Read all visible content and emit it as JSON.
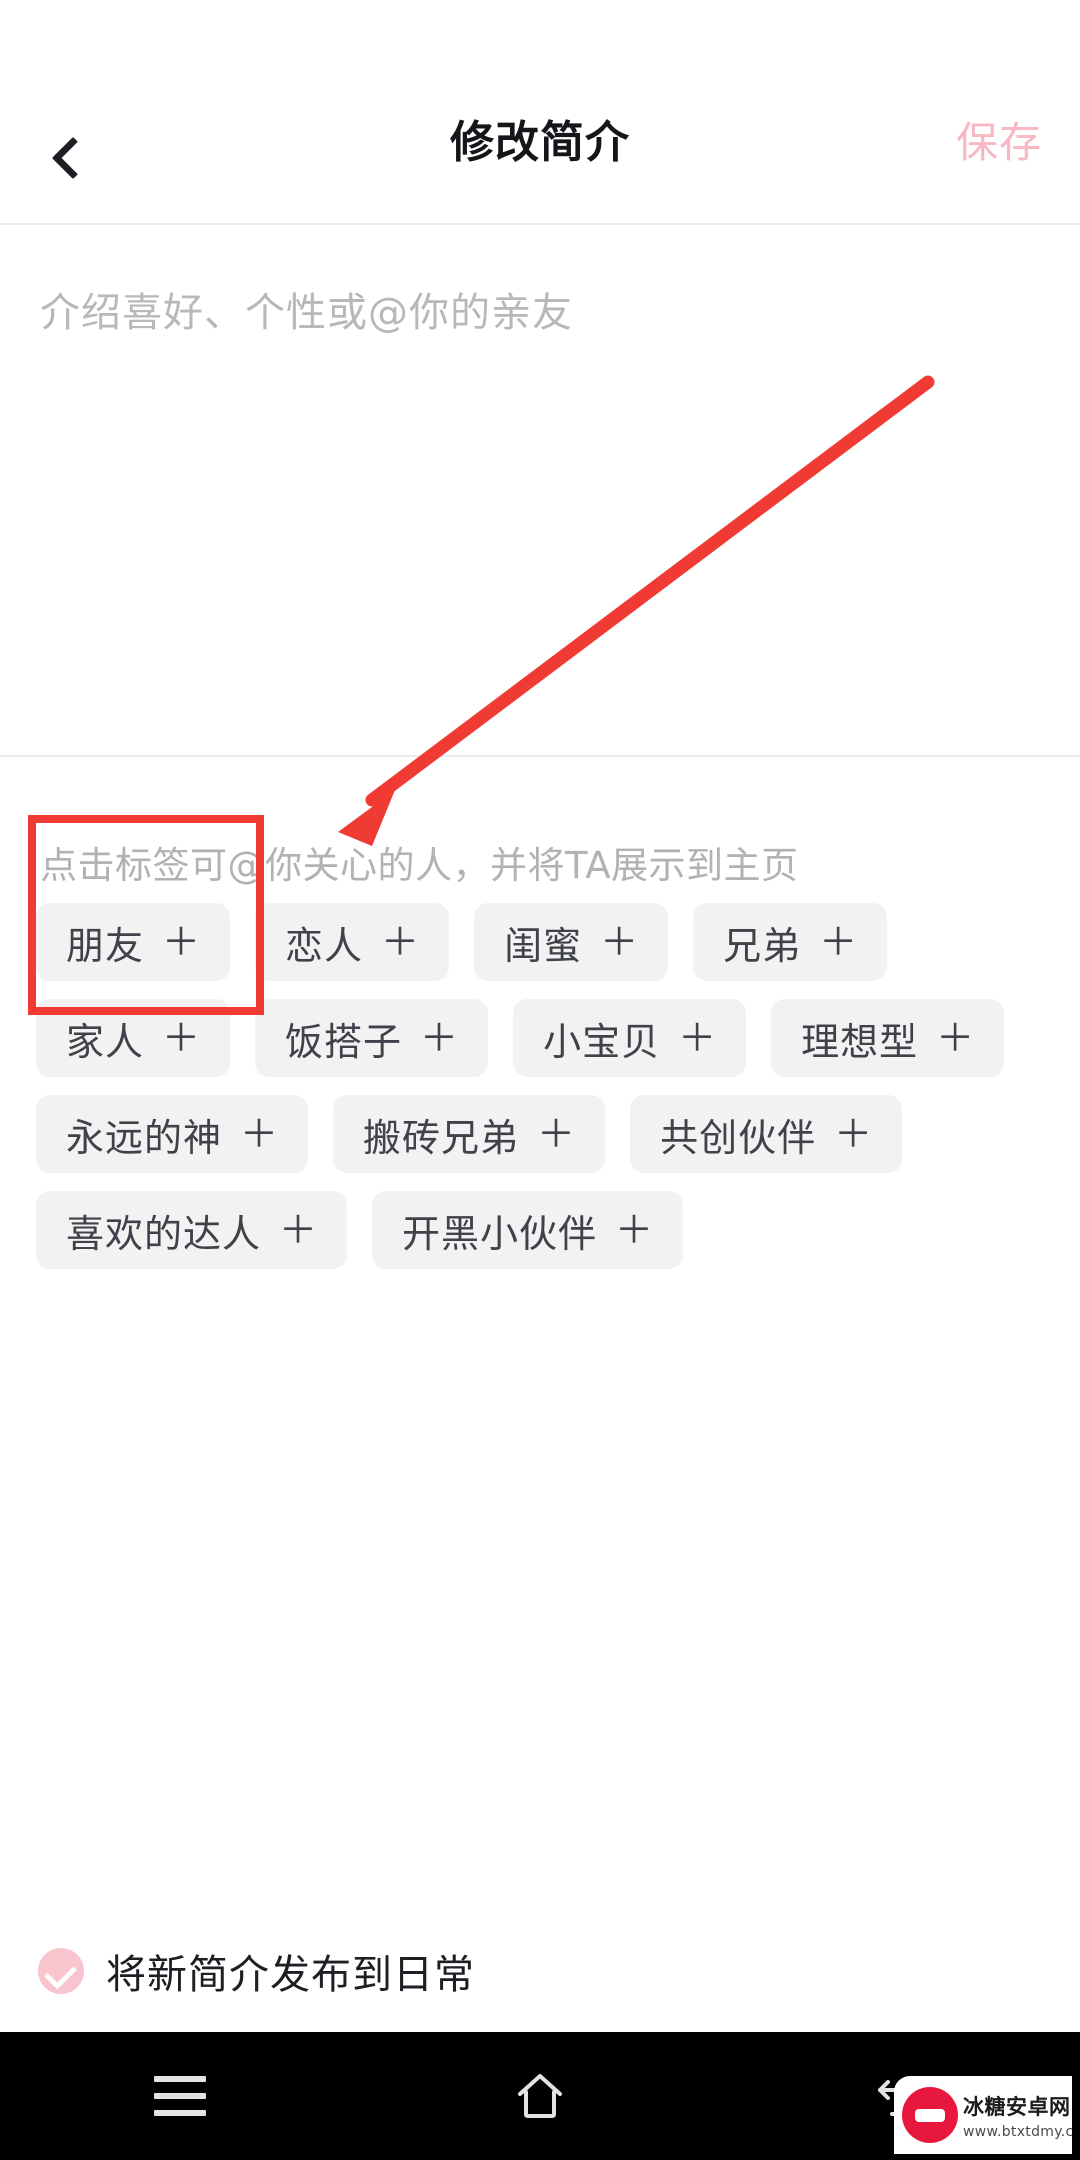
{
  "header": {
    "back_icon": "chevron-left-icon",
    "title": "修改简介",
    "save_label": "保存",
    "save_color": "#f7b8c2"
  },
  "bio": {
    "value": "",
    "placeholder": "介绍喜好、个性或@你的亲友"
  },
  "tag_section": {
    "hint": "点击标签可@你关心的人，并将TA展示到主页",
    "plus_glyph": "＋",
    "rows": [
      [
        {
          "label": "朋友"
        },
        {
          "label": "恋人"
        },
        {
          "label": "闺蜜"
        },
        {
          "label": "兄弟"
        }
      ],
      [
        {
          "label": "家人"
        },
        {
          "label": "饭搭子"
        },
        {
          "label": "小宝贝"
        },
        {
          "label": "理想型"
        }
      ],
      [
        {
          "label": "永远的神"
        },
        {
          "label": "搬砖兄弟"
        },
        {
          "label": "共创伙伴"
        }
      ],
      [
        {
          "label": "喜欢的达人"
        },
        {
          "label": "开黑小伙伴"
        }
      ]
    ]
  },
  "publish": {
    "label": "将新简介发布到日常",
    "checked": true,
    "check_color": "#f8c4ce"
  },
  "navbar": {
    "menu_icon": "hamburger-menu-icon",
    "home_icon": "home-icon",
    "back_icon": "back-arrow-icon"
  },
  "watermark": {
    "name": "冰糖安卓网",
    "url": "www.btxtdmy.com"
  },
  "annotations": {
    "color": "#ef3b33",
    "highlight_box": "朋友",
    "arrow_from": "top-right",
    "arrow_to": "朋友"
  }
}
